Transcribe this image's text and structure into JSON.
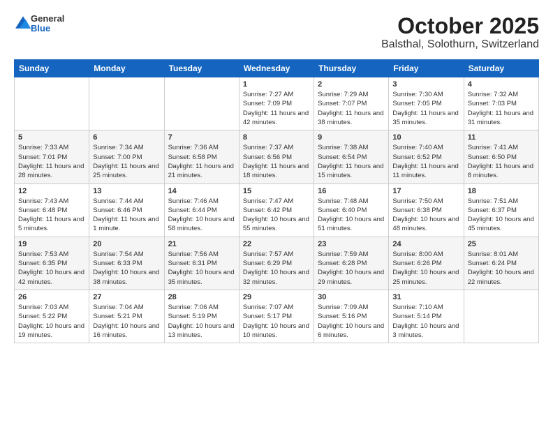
{
  "logo": {
    "general": "General",
    "blue": "Blue"
  },
  "title": "October 2025",
  "location": "Balsthal, Solothurn, Switzerland",
  "days_of_week": [
    "Sunday",
    "Monday",
    "Tuesday",
    "Wednesday",
    "Thursday",
    "Friday",
    "Saturday"
  ],
  "weeks": [
    [
      {
        "day": "",
        "info": ""
      },
      {
        "day": "",
        "info": ""
      },
      {
        "day": "",
        "info": ""
      },
      {
        "day": "1",
        "info": "Sunrise: 7:27 AM\nSunset: 7:09 PM\nDaylight: 11 hours and 42 minutes."
      },
      {
        "day": "2",
        "info": "Sunrise: 7:29 AM\nSunset: 7:07 PM\nDaylight: 11 hours and 38 minutes."
      },
      {
        "day": "3",
        "info": "Sunrise: 7:30 AM\nSunset: 7:05 PM\nDaylight: 11 hours and 35 minutes."
      },
      {
        "day": "4",
        "info": "Sunrise: 7:32 AM\nSunset: 7:03 PM\nDaylight: 11 hours and 31 minutes."
      }
    ],
    [
      {
        "day": "5",
        "info": "Sunrise: 7:33 AM\nSunset: 7:01 PM\nDaylight: 11 hours and 28 minutes."
      },
      {
        "day": "6",
        "info": "Sunrise: 7:34 AM\nSunset: 7:00 PM\nDaylight: 11 hours and 25 minutes."
      },
      {
        "day": "7",
        "info": "Sunrise: 7:36 AM\nSunset: 6:58 PM\nDaylight: 11 hours and 21 minutes."
      },
      {
        "day": "8",
        "info": "Sunrise: 7:37 AM\nSunset: 6:56 PM\nDaylight: 11 hours and 18 minutes."
      },
      {
        "day": "9",
        "info": "Sunrise: 7:38 AM\nSunset: 6:54 PM\nDaylight: 11 hours and 15 minutes."
      },
      {
        "day": "10",
        "info": "Sunrise: 7:40 AM\nSunset: 6:52 PM\nDaylight: 11 hours and 11 minutes."
      },
      {
        "day": "11",
        "info": "Sunrise: 7:41 AM\nSunset: 6:50 PM\nDaylight: 11 hours and 8 minutes."
      }
    ],
    [
      {
        "day": "12",
        "info": "Sunrise: 7:43 AM\nSunset: 6:48 PM\nDaylight: 11 hours and 5 minutes."
      },
      {
        "day": "13",
        "info": "Sunrise: 7:44 AM\nSunset: 6:46 PM\nDaylight: 11 hours and 1 minute."
      },
      {
        "day": "14",
        "info": "Sunrise: 7:46 AM\nSunset: 6:44 PM\nDaylight: 10 hours and 58 minutes."
      },
      {
        "day": "15",
        "info": "Sunrise: 7:47 AM\nSunset: 6:42 PM\nDaylight: 10 hours and 55 minutes."
      },
      {
        "day": "16",
        "info": "Sunrise: 7:48 AM\nSunset: 6:40 PM\nDaylight: 10 hours and 51 minutes."
      },
      {
        "day": "17",
        "info": "Sunrise: 7:50 AM\nSunset: 6:38 PM\nDaylight: 10 hours and 48 minutes."
      },
      {
        "day": "18",
        "info": "Sunrise: 7:51 AM\nSunset: 6:37 PM\nDaylight: 10 hours and 45 minutes."
      }
    ],
    [
      {
        "day": "19",
        "info": "Sunrise: 7:53 AM\nSunset: 6:35 PM\nDaylight: 10 hours and 42 minutes."
      },
      {
        "day": "20",
        "info": "Sunrise: 7:54 AM\nSunset: 6:33 PM\nDaylight: 10 hours and 38 minutes."
      },
      {
        "day": "21",
        "info": "Sunrise: 7:56 AM\nSunset: 6:31 PM\nDaylight: 10 hours and 35 minutes."
      },
      {
        "day": "22",
        "info": "Sunrise: 7:57 AM\nSunset: 6:29 PM\nDaylight: 10 hours and 32 minutes."
      },
      {
        "day": "23",
        "info": "Sunrise: 7:59 AM\nSunset: 6:28 PM\nDaylight: 10 hours and 29 minutes."
      },
      {
        "day": "24",
        "info": "Sunrise: 8:00 AM\nSunset: 6:26 PM\nDaylight: 10 hours and 25 minutes."
      },
      {
        "day": "25",
        "info": "Sunrise: 8:01 AM\nSunset: 6:24 PM\nDaylight: 10 hours and 22 minutes."
      }
    ],
    [
      {
        "day": "26",
        "info": "Sunrise: 7:03 AM\nSunset: 5:22 PM\nDaylight: 10 hours and 19 minutes."
      },
      {
        "day": "27",
        "info": "Sunrise: 7:04 AM\nSunset: 5:21 PM\nDaylight: 10 hours and 16 minutes."
      },
      {
        "day": "28",
        "info": "Sunrise: 7:06 AM\nSunset: 5:19 PM\nDaylight: 10 hours and 13 minutes."
      },
      {
        "day": "29",
        "info": "Sunrise: 7:07 AM\nSunset: 5:17 PM\nDaylight: 10 hours and 10 minutes."
      },
      {
        "day": "30",
        "info": "Sunrise: 7:09 AM\nSunset: 5:16 PM\nDaylight: 10 hours and 6 minutes."
      },
      {
        "day": "31",
        "info": "Sunrise: 7:10 AM\nSunset: 5:14 PM\nDaylight: 10 hours and 3 minutes."
      },
      {
        "day": "",
        "info": ""
      }
    ]
  ]
}
